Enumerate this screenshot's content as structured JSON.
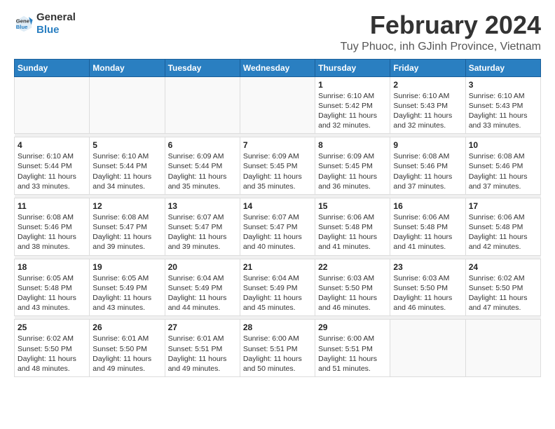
{
  "logo": {
    "general": "General",
    "blue": "Blue"
  },
  "header": {
    "title": "February 2024",
    "subtitle": "Tuy Phuoc, inh GJinh Province, Vietnam"
  },
  "weekdays": [
    "Sunday",
    "Monday",
    "Tuesday",
    "Wednesday",
    "Thursday",
    "Friday",
    "Saturday"
  ],
  "weeks": [
    [
      {
        "day": "",
        "info": ""
      },
      {
        "day": "",
        "info": ""
      },
      {
        "day": "",
        "info": ""
      },
      {
        "day": "",
        "info": ""
      },
      {
        "day": "1",
        "info": "Sunrise: 6:10 AM\nSunset: 5:42 PM\nDaylight: 11 hours and 32 minutes."
      },
      {
        "day": "2",
        "info": "Sunrise: 6:10 AM\nSunset: 5:43 PM\nDaylight: 11 hours and 32 minutes."
      },
      {
        "day": "3",
        "info": "Sunrise: 6:10 AM\nSunset: 5:43 PM\nDaylight: 11 hours and 33 minutes."
      }
    ],
    [
      {
        "day": "4",
        "info": "Sunrise: 6:10 AM\nSunset: 5:44 PM\nDaylight: 11 hours and 33 minutes."
      },
      {
        "day": "5",
        "info": "Sunrise: 6:10 AM\nSunset: 5:44 PM\nDaylight: 11 hours and 34 minutes."
      },
      {
        "day": "6",
        "info": "Sunrise: 6:09 AM\nSunset: 5:44 PM\nDaylight: 11 hours and 35 minutes."
      },
      {
        "day": "7",
        "info": "Sunrise: 6:09 AM\nSunset: 5:45 PM\nDaylight: 11 hours and 35 minutes."
      },
      {
        "day": "8",
        "info": "Sunrise: 6:09 AM\nSunset: 5:45 PM\nDaylight: 11 hours and 36 minutes."
      },
      {
        "day": "9",
        "info": "Sunrise: 6:08 AM\nSunset: 5:46 PM\nDaylight: 11 hours and 37 minutes."
      },
      {
        "day": "10",
        "info": "Sunrise: 6:08 AM\nSunset: 5:46 PM\nDaylight: 11 hours and 37 minutes."
      }
    ],
    [
      {
        "day": "11",
        "info": "Sunrise: 6:08 AM\nSunset: 5:46 PM\nDaylight: 11 hours and 38 minutes."
      },
      {
        "day": "12",
        "info": "Sunrise: 6:08 AM\nSunset: 5:47 PM\nDaylight: 11 hours and 39 minutes."
      },
      {
        "day": "13",
        "info": "Sunrise: 6:07 AM\nSunset: 5:47 PM\nDaylight: 11 hours and 39 minutes."
      },
      {
        "day": "14",
        "info": "Sunrise: 6:07 AM\nSunset: 5:47 PM\nDaylight: 11 hours and 40 minutes."
      },
      {
        "day": "15",
        "info": "Sunrise: 6:06 AM\nSunset: 5:48 PM\nDaylight: 11 hours and 41 minutes."
      },
      {
        "day": "16",
        "info": "Sunrise: 6:06 AM\nSunset: 5:48 PM\nDaylight: 11 hours and 41 minutes."
      },
      {
        "day": "17",
        "info": "Sunrise: 6:06 AM\nSunset: 5:48 PM\nDaylight: 11 hours and 42 minutes."
      }
    ],
    [
      {
        "day": "18",
        "info": "Sunrise: 6:05 AM\nSunset: 5:48 PM\nDaylight: 11 hours and 43 minutes."
      },
      {
        "day": "19",
        "info": "Sunrise: 6:05 AM\nSunset: 5:49 PM\nDaylight: 11 hours and 43 minutes."
      },
      {
        "day": "20",
        "info": "Sunrise: 6:04 AM\nSunset: 5:49 PM\nDaylight: 11 hours and 44 minutes."
      },
      {
        "day": "21",
        "info": "Sunrise: 6:04 AM\nSunset: 5:49 PM\nDaylight: 11 hours and 45 minutes."
      },
      {
        "day": "22",
        "info": "Sunrise: 6:03 AM\nSunset: 5:50 PM\nDaylight: 11 hours and 46 minutes."
      },
      {
        "day": "23",
        "info": "Sunrise: 6:03 AM\nSunset: 5:50 PM\nDaylight: 11 hours and 46 minutes."
      },
      {
        "day": "24",
        "info": "Sunrise: 6:02 AM\nSunset: 5:50 PM\nDaylight: 11 hours and 47 minutes."
      }
    ],
    [
      {
        "day": "25",
        "info": "Sunrise: 6:02 AM\nSunset: 5:50 PM\nDaylight: 11 hours and 48 minutes."
      },
      {
        "day": "26",
        "info": "Sunrise: 6:01 AM\nSunset: 5:50 PM\nDaylight: 11 hours and 49 minutes."
      },
      {
        "day": "27",
        "info": "Sunrise: 6:01 AM\nSunset: 5:51 PM\nDaylight: 11 hours and 49 minutes."
      },
      {
        "day": "28",
        "info": "Sunrise: 6:00 AM\nSunset: 5:51 PM\nDaylight: 11 hours and 50 minutes."
      },
      {
        "day": "29",
        "info": "Sunrise: 6:00 AM\nSunset: 5:51 PM\nDaylight: 11 hours and 51 minutes."
      },
      {
        "day": "",
        "info": ""
      },
      {
        "day": "",
        "info": ""
      }
    ]
  ]
}
